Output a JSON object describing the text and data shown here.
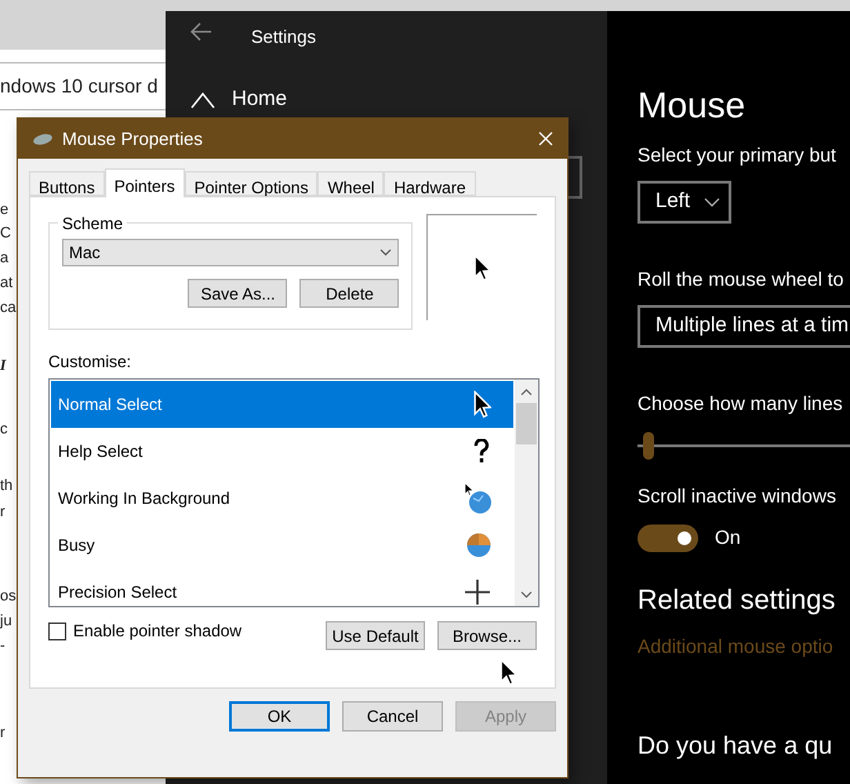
{
  "background_page": {
    "search_text": "ndows 10 cursor d",
    "fragments": [
      "e",
      "C",
      "a",
      "at",
      "ca",
      "I",
      "c",
      "th",
      "r",
      "os",
      "ju",
      "-",
      "r"
    ]
  },
  "settings": {
    "title": "Settings",
    "nav_home": "Home",
    "heading": "Mouse",
    "primary_button_label": "Select your primary but",
    "primary_button_value": "Left",
    "wheel_label": "Roll the mouse wheel to",
    "wheel_value": "Multiple lines at a tim",
    "lines_label": "Choose how many lines",
    "lines_slider": {
      "level": 0.0
    },
    "inactive_label": "Scroll inactive windows",
    "inactive_toggle": {
      "on": true,
      "text": "On"
    },
    "related_heading": "Related settings",
    "related_link": "Additional mouse optio",
    "question_heading": "Do you have a qu"
  },
  "dialog": {
    "title": "Mouse Properties",
    "tabs": [
      {
        "label": "Buttons",
        "selected": false
      },
      {
        "label": "Pointers",
        "selected": true
      },
      {
        "label": "Pointer Options",
        "selected": false
      },
      {
        "label": "Wheel",
        "selected": false
      },
      {
        "label": "Hardware",
        "selected": false
      }
    ],
    "scheme": {
      "legend": "Scheme",
      "value": "Mac",
      "buttons": [
        "Save As...",
        "Delete"
      ]
    },
    "customise_label": "Customise:",
    "pointers": [
      {
        "name": "Normal Select",
        "selected": true
      },
      {
        "name": "Help Select",
        "selected": false
      },
      {
        "name": "Working In Background",
        "selected": false
      },
      {
        "name": "Busy",
        "selected": false
      },
      {
        "name": "Precision Select",
        "selected": false
      }
    ],
    "shadow_checkbox": {
      "label": "Enable pointer shadow",
      "checked": false
    },
    "list_buttons": [
      "Use Default",
      "Browse..."
    ],
    "footer_buttons": [
      {
        "label": "OK",
        "disabled": false,
        "default": true
      },
      {
        "label": "Cancel",
        "disabled": false,
        "default": false
      },
      {
        "label": "Apply",
        "disabled": true,
        "default": false
      }
    ]
  }
}
